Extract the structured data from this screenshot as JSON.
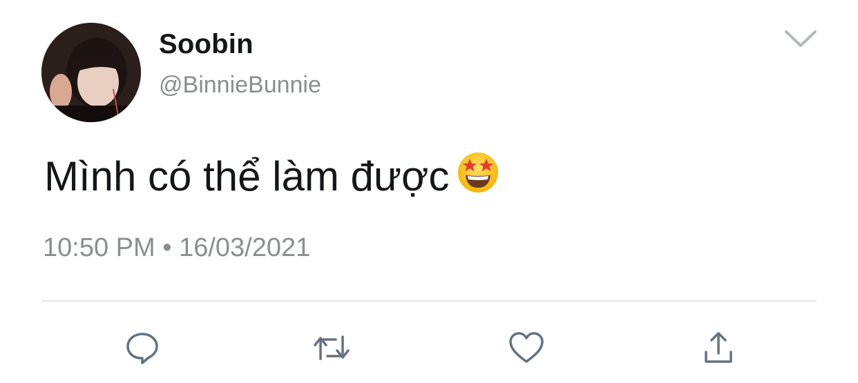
{
  "author": {
    "name": "Soobin",
    "handle": "@BinnieBunnie"
  },
  "tweet": {
    "text": "Mình có thể làm được",
    "emoji": "star-struck-emoji",
    "timestamp": "10:50 PM • 16/03/2021"
  },
  "actions": [
    {
      "icon": "reply-icon"
    },
    {
      "icon": "retweet-icon"
    },
    {
      "icon": "like-icon"
    },
    {
      "icon": "share-icon"
    }
  ],
  "colors": {
    "text_primary": "#14171a",
    "text_secondary": "#8a8d91",
    "icon_gray": "#66717f",
    "divider": "#dfe2e5"
  }
}
